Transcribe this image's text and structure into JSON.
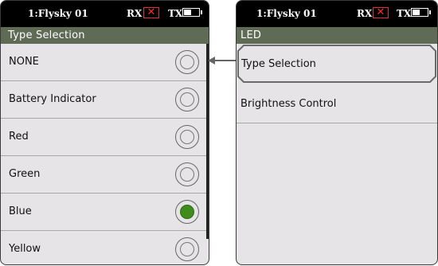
{
  "left_screen": {
    "status": {
      "model": "1:Flysky 01",
      "rx": "RX",
      "rx_state": "✕",
      "tx": "TX"
    },
    "title": "Type Selection",
    "items": [
      {
        "label": "NONE",
        "selected": false
      },
      {
        "label": "Battery Indicator",
        "selected": false
      },
      {
        "label": "Red",
        "selected": false
      },
      {
        "label": "Green",
        "selected": false
      },
      {
        "label": "Blue",
        "selected": true
      },
      {
        "label": "Yellow",
        "selected": false
      }
    ]
  },
  "right_screen": {
    "status": {
      "model": "1:Flysky 01",
      "rx": "RX",
      "rx_state": "✕",
      "tx": "TX"
    },
    "title": "LED",
    "items": [
      {
        "label": "Type Selection",
        "highlighted": true
      },
      {
        "label": "Brightness Control",
        "highlighted": false
      }
    ]
  },
  "colors": {
    "titlebar": "#5f6b55",
    "selected_radio": "#3f8c1c",
    "rx_alert": "#ff2a2a"
  }
}
